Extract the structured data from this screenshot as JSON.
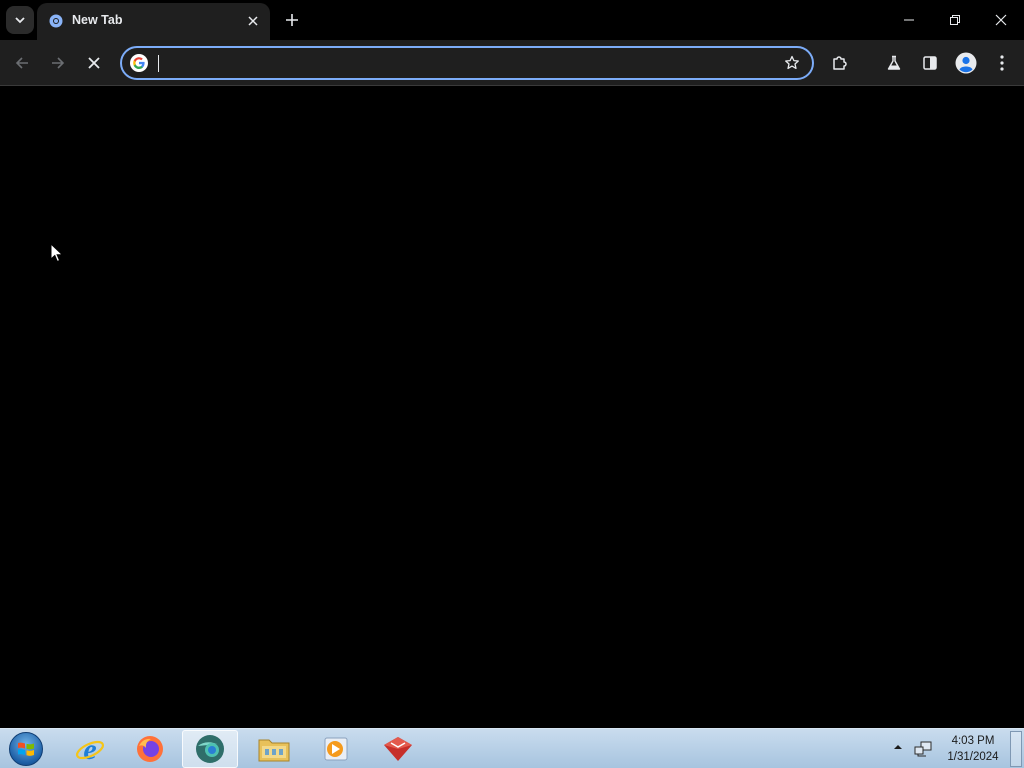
{
  "browser": {
    "tab": {
      "title": "New Tab",
      "favicon": "chromium-icon",
      "close_icon": "close-icon"
    },
    "tab_search_icon": "chevron-down-icon",
    "new_tab_icon": "plus-icon",
    "window_controls": [
      "minimize-icon",
      "restore-icon",
      "close-icon"
    ],
    "toolbar": {
      "back_icon": "arrow-left-icon",
      "forward_icon": "arrow-right-icon",
      "stop_icon": "close-icon",
      "omnibox": {
        "value": "",
        "placeholder": "",
        "search_engine_icon": "google-icon",
        "bookmark_icon": "star-icon"
      },
      "extensions_icon": "puzzle-icon",
      "labs_icon": "flask-icon",
      "side_panel_icon": "side-panel-icon",
      "profile_icon": "avatar-icon",
      "menu_icon": "kebab-menu-icon"
    },
    "accent": "#7cacf8"
  },
  "taskbar": {
    "start_icon": "windows-orb-icon",
    "pinned": [
      {
        "name": "internet-explorer-icon",
        "active": false
      },
      {
        "name": "firefox-icon",
        "active": false
      },
      {
        "name": "chromium-icon",
        "active": true
      },
      {
        "name": "file-explorer-icon",
        "active": false
      },
      {
        "name": "media-player-icon",
        "active": false
      },
      {
        "name": "app-red-icon",
        "active": false
      }
    ],
    "tray": {
      "show_hidden_icon": "triangle-up-icon",
      "network_icon": "network-icon",
      "time": "4:03 PM",
      "date": "1/31/2024"
    }
  }
}
